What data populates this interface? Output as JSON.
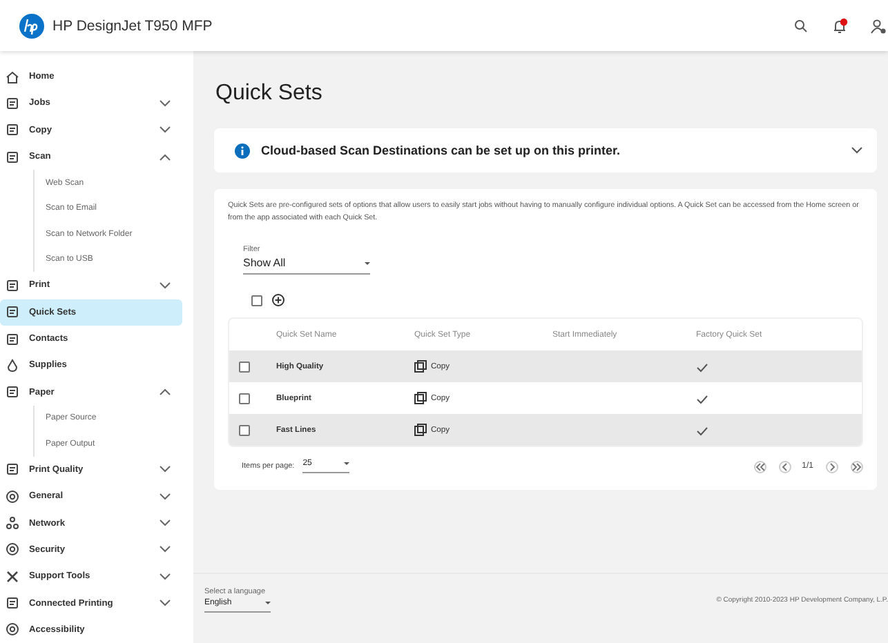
{
  "header": {
    "title": "HP DesignJet T950 MFP",
    "notification_badge": true
  },
  "sidebar": {
    "items": [
      {
        "label": "Home",
        "selected": false
      },
      {
        "label": "Jobs",
        "selected": false,
        "expanded": false
      },
      {
        "label": "Copy",
        "selected": false,
        "expanded": false
      },
      {
        "label": "Scan",
        "selected": false,
        "expanded": true,
        "children": [
          {
            "label": "Web Scan",
            "selected": false
          },
          {
            "label": "Scan to Email",
            "selected": false
          },
          {
            "label": "Scan to Network Folder",
            "selected": false
          },
          {
            "label": "Scan to USB",
            "selected": false
          }
        ]
      },
      {
        "label": "Print",
        "selected": false,
        "expanded": false
      },
      {
        "label": "Quick Sets",
        "selected": true
      },
      {
        "label": "Contacts",
        "selected": false
      },
      {
        "label": "Supplies",
        "selected": false
      },
      {
        "label": "Paper",
        "selected": false,
        "expanded": true,
        "children": [
          {
            "label": "Paper Source",
            "selected": false
          },
          {
            "label": "Paper Output",
            "selected": false
          }
        ]
      },
      {
        "label": "Print Quality",
        "selected": false,
        "expanded": false
      },
      {
        "label": "General",
        "selected": false,
        "expanded": false
      },
      {
        "label": "Network",
        "selected": false,
        "expanded": false
      },
      {
        "label": "Security",
        "selected": false,
        "expanded": false
      },
      {
        "label": "Support Tools",
        "selected": false,
        "expanded": false
      },
      {
        "label": "Connected Printing",
        "selected": false,
        "expanded": false
      },
      {
        "label": "Accessibility",
        "selected": false
      }
    ]
  },
  "page_title": "Quick Sets",
  "banner": {
    "text": "Cloud-based Scan Destinations can be set up on this printer.",
    "expanded": false
  },
  "description": "Quick Sets are pre-configured sets of options that allow users to easily start jobs without having to manually configure individual options. A Quick Set can be accessed from the Home screen or from the app associated with each Quick Set.",
  "filter": {
    "label": "Filter",
    "value": "Show All"
  },
  "select_all_checked": false,
  "table": {
    "columns": [
      "Quick Set Name",
      "Quick Set Type",
      "Start Immediately",
      "Factory Quick Set"
    ],
    "rows": [
      {
        "name": "High Quality",
        "type": "Copy",
        "start_immediately": false,
        "factory": true,
        "checked": false
      },
      {
        "name": "Blueprint",
        "type": "Copy",
        "start_immediately": false,
        "factory": true,
        "checked": false
      },
      {
        "name": "Fast Lines",
        "type": "Copy",
        "start_immediately": false,
        "factory": true,
        "checked": false
      }
    ]
  },
  "pagination": {
    "items_label": "Items per page:",
    "items_value": "25",
    "page": "1/1"
  },
  "footer": {
    "language_label": "Select a language",
    "language_value": "English",
    "copyright": "© Copyright 2010-2023 HP Development Company, L.P."
  }
}
